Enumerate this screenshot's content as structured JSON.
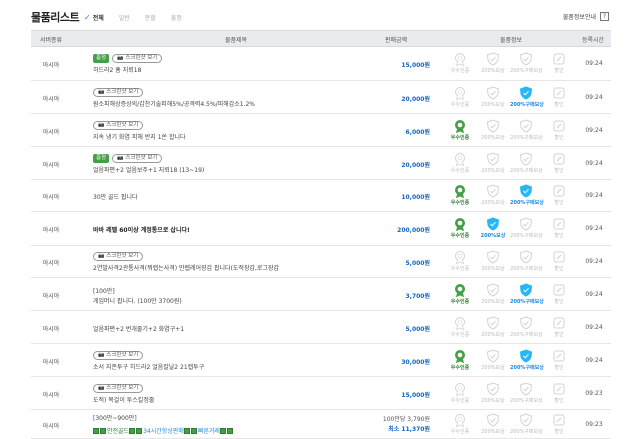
{
  "header": {
    "title": "물품리스트",
    "filters": [
      {
        "label": "전체",
        "active": true
      },
      {
        "label": "일반",
        "active": false
      },
      {
        "label": "분할",
        "active": false
      },
      {
        "label": "흥정",
        "active": false
      }
    ],
    "guide_label": "물품정보안내",
    "guide_icon": "?"
  },
  "columns": {
    "server": "서버종류",
    "title": "물품제목",
    "price": "판매금액",
    "info": "물품정보",
    "time": "등록시간"
  },
  "badge_labels": {
    "certified": "우수인증",
    "compensation": "200%보상",
    "buy_compensation": "200%구매보상",
    "discount": "할인"
  },
  "tags": {
    "urgent": "흥정",
    "screenshot": "스크린샷 보기"
  },
  "rows": [
    {
      "server": "아시아",
      "title": "히드라2 홈 지뢰18",
      "price": "15,000원",
      "time": "09:24",
      "urgent": true,
      "screenshot": true
    },
    {
      "server": "아시아",
      "title": "원소피해상증상의/갑찬기술피해5%/공격력4.5%/피해감소1.2%",
      "price": "20,000원",
      "time": "09:24",
      "urgent": false,
      "screenshot": true
    },
    {
      "server": "아시아",
      "title": "지속 냉기 화염 피해 반지 1쏜 합니다",
      "price": "6,000원",
      "time": "09:24",
      "urgent": false,
      "screenshot": true
    },
    {
      "server": "아시아",
      "title": "얼음파편+2 얼음보주+1 지뢰18 (13~19)",
      "price": "20,000원",
      "time": "09:24",
      "urgent": true,
      "screenshot": true
    },
    {
      "server": "아시아",
      "title": "30만 골드 팝니다",
      "price": "10,000원",
      "time": "09:24",
      "urgent": false,
      "screenshot": false
    },
    {
      "server": "아시아",
      "title": "바바 레벨 60이상 계정통으로 삽니다!",
      "price": "200,000원",
      "time": "09:24",
      "urgent": false,
      "screenshot": false,
      "bold": true
    },
    {
      "server": "아시아",
      "title": "2연발사격2관통사격(뭐랩는사격) 만렙레어장갑 팝니다(도적장갑,로그장갑",
      "price": "5,000원",
      "time": "09:24",
      "urgent": false,
      "screenshot": true
    },
    {
      "server": "아시아",
      "title_line1": "[100만]",
      "title": "게임머니 팝니다. (100만 3700원)",
      "price": "3,700원",
      "time": "09:24"
    },
    {
      "server": "아시아",
      "title": "얼음파편+2 번개줄기+2 화염구+1",
      "price": "5,000원",
      "time": "09:24"
    },
    {
      "server": "아시아",
      "title": "소서 지존투구 히드라2 얼음칼날2 21캡투구",
      "price": "30,000원",
      "time": "09:24",
      "screenshot": true
    },
    {
      "server": "아시아",
      "title": "도적) 목걸이 투스킬정줄",
      "price": "15,000원",
      "time": "09:23",
      "screenshot": true
    },
    {
      "server": "아시아",
      "title_line1": "[300만~900만]",
      "price_sub": "100만당 3,790원",
      "price": "최소 11,370원",
      "time": "09:23",
      "promo": {
        "p1": "안전골드",
        "p2": "34시간항상판매",
        "p3": "빠른거래"
      }
    }
  ]
}
